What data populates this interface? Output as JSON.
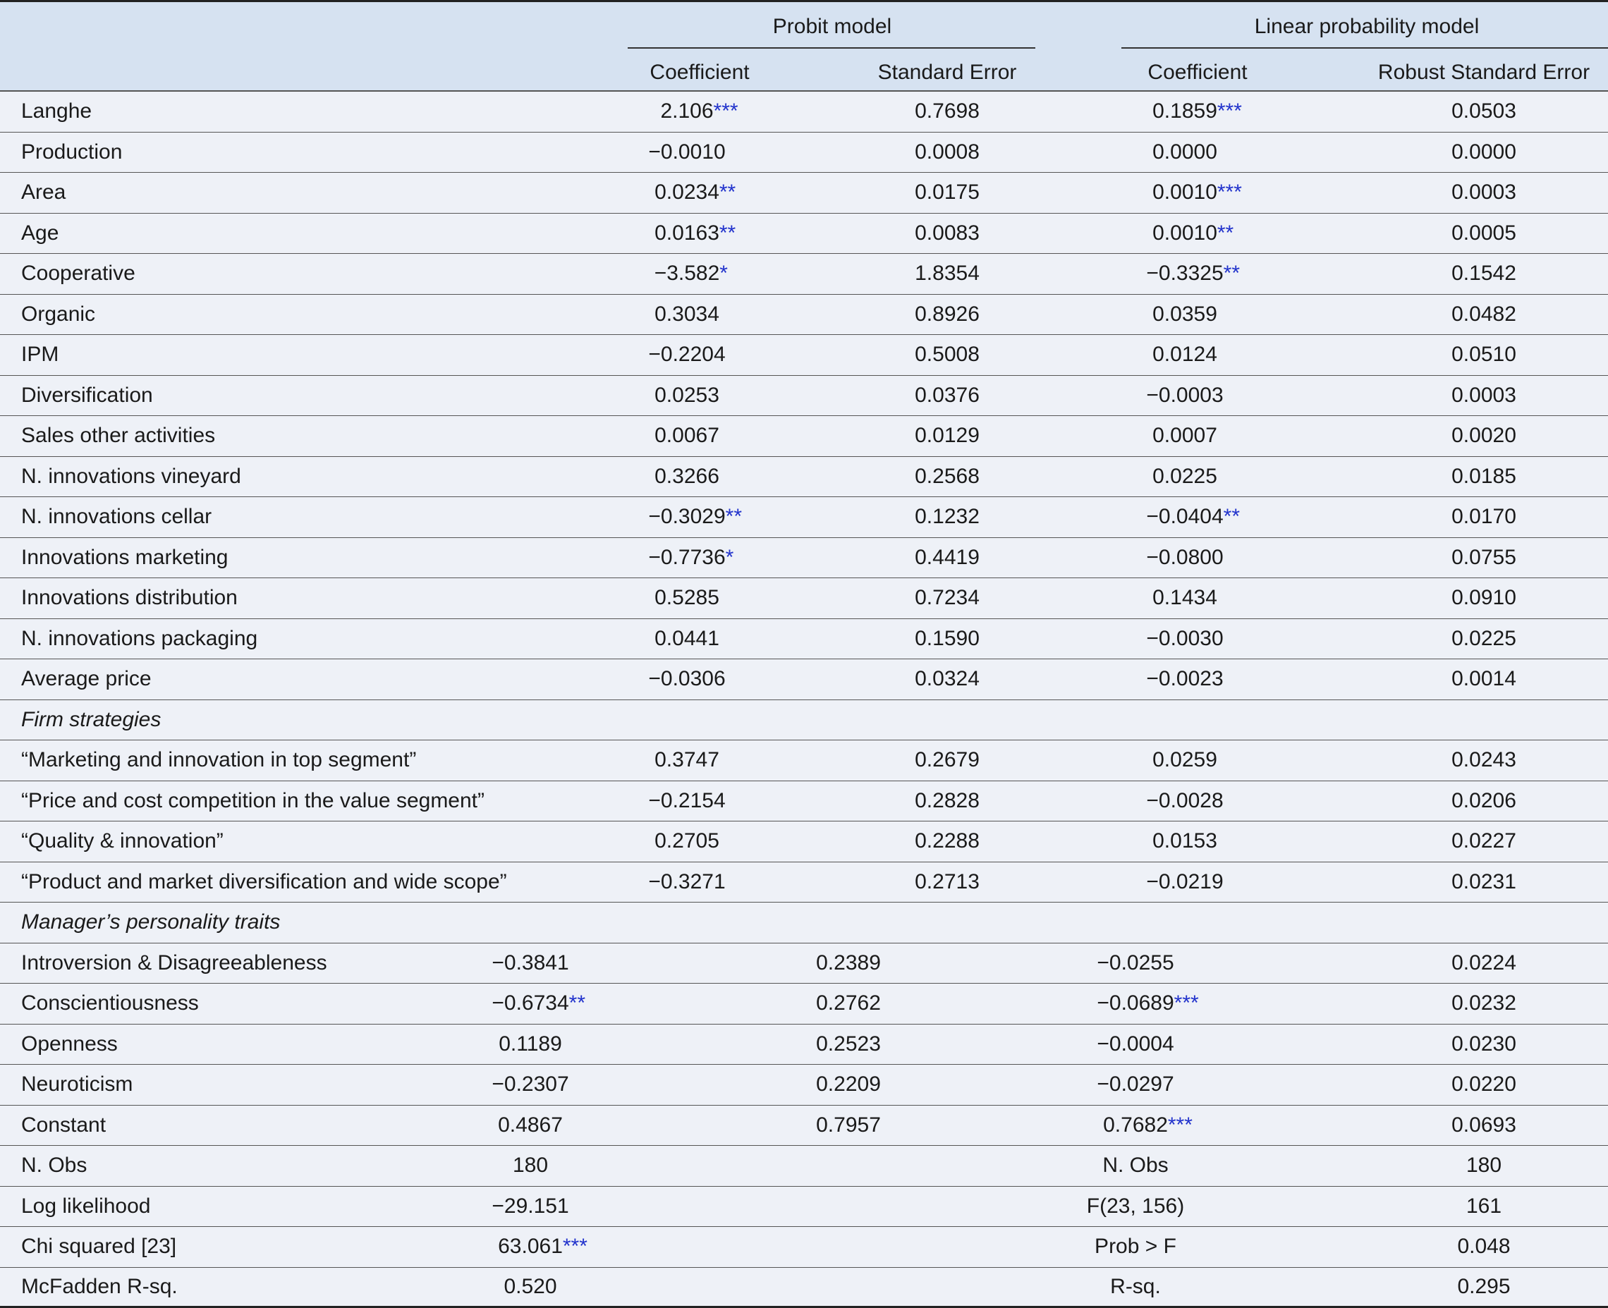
{
  "header": {
    "group_probit": "Probit model",
    "group_lpm": "Linear probability model",
    "col_probit_coef": "Coefficient",
    "col_probit_se": "Standard Error",
    "col_lpm_coef": "Coefficient",
    "col_lpm_se": "Robust Standard Error"
  },
  "rows": [
    {
      "label": "Langhe",
      "pc": "2.106",
      "pcs": "***",
      "pse": "0.7698",
      "lc": "0.1859",
      "lcs": "***",
      "lse": "0.0503"
    },
    {
      "label": "Production",
      "pc": "−0.0010",
      "pcs": "",
      "pse": "0.0008",
      "lc": "0.0000",
      "lcs": "",
      "lse": "0.0000"
    },
    {
      "label": "Area",
      "pc": "0.0234",
      "pcs": "**",
      "pse": "0.0175",
      "lc": "0.0010",
      "lcs": "***",
      "lse": "0.0003"
    },
    {
      "label": "Age",
      "pc": "0.0163",
      "pcs": "**",
      "pse": "0.0083",
      "lc": "0.0010",
      "lcs": "**",
      "lse": "0.0005"
    },
    {
      "label": "Cooperative",
      "pc": "−3.582",
      "pcs": "*",
      "pse": "1.8354",
      "lc": "−0.3325",
      "lcs": "**",
      "lse": "0.1542"
    },
    {
      "label": "Organic",
      "pc": "0.3034",
      "pcs": "",
      "pse": "0.8926",
      "lc": "0.0359",
      "lcs": "",
      "lse": "0.0482"
    },
    {
      "label": "IPM",
      "pc": "−0.2204",
      "pcs": "",
      "pse": "0.5008",
      "lc": "0.0124",
      "lcs": "",
      "lse": "0.0510"
    },
    {
      "label": "Diversification",
      "pc": "0.0253",
      "pcs": "",
      "pse": "0.0376",
      "lc": "−0.0003",
      "lcs": "",
      "lse": "0.0003"
    },
    {
      "label": "Sales other activities",
      "pc": "0.0067",
      "pcs": "",
      "pse": "0.0129",
      "lc": "0.0007",
      "lcs": "",
      "lse": "0.0020"
    },
    {
      "label": "N. innovations vineyard",
      "pc": "0.3266",
      "pcs": "",
      "pse": "0.2568",
      "lc": "0.0225",
      "lcs": "",
      "lse": "0.0185"
    },
    {
      "label": "N. innovations cellar",
      "pc": "−0.3029",
      "pcs": "**",
      "pse": "0.1232",
      "lc": "−0.0404",
      "lcs": "**",
      "lse": "0.0170"
    },
    {
      "label": "Innovations marketing",
      "pc": "−0.7736",
      "pcs": "*",
      "pse": "0.4419",
      "lc": "−0.0800",
      "lcs": "",
      "lse": "0.0755"
    },
    {
      "label": "Innovations distribution",
      "pc": "0.5285",
      "pcs": "",
      "pse": "0.7234",
      "lc": "0.1434",
      "lcs": "",
      "lse": "0.0910"
    },
    {
      "label": "N. innovations packaging",
      "pc": "0.0441",
      "pcs": "",
      "pse": "0.1590",
      "lc": "−0.0030",
      "lcs": "",
      "lse": "0.0225"
    },
    {
      "label": "Average price",
      "pc": "−0.0306",
      "pcs": "",
      "pse": "0.0324",
      "lc": "−0.0023",
      "lcs": "",
      "lse": "0.0014"
    },
    {
      "label": "Firm strategies",
      "section": true
    },
    {
      "label": "“Marketing and innovation in top segment”",
      "pc": "0.3747",
      "pcs": "",
      "pse": "0.2679",
      "lc": "0.0259",
      "lcs": "",
      "lse": "0.0243"
    },
    {
      "label": "“Price and cost competition in the value segment”",
      "pc": "−0.2154",
      "pcs": "",
      "pse": "0.2828",
      "lc": "−0.0028",
      "lcs": "",
      "lse": "0.0206"
    },
    {
      "label": "“Quality & innovation”",
      "pc": "0.2705",
      "pcs": "",
      "pse": "0.2288",
      "lc": "0.0153",
      "lcs": "",
      "lse": "0.0227"
    },
    {
      "label": "“Product and market diversification and wide scope”",
      "pc": "−0.3271",
      "pcs": "",
      "pse": "0.2713",
      "lc": "−0.0219",
      "lcs": "",
      "lse": "0.0231"
    },
    {
      "label": "Manager’s personality traits",
      "section": true
    },
    {
      "label": "Introversion & Disagreeableness",
      "pc": "−0.3841",
      "pcs": "",
      "pse": "0.2389",
      "lc": "−0.0255",
      "lcs": "",
      "lse": "0.0224",
      "shifted": true
    },
    {
      "label": "Conscientiousness",
      "pc": "−0.6734",
      "pcs": "**",
      "pse": "0.2762",
      "lc": "−0.0689",
      "lcs": "***",
      "lse": "0.0232",
      "shifted": true
    },
    {
      "label": "Openness",
      "pc": "0.1189",
      "pcs": "",
      "pse": "0.2523",
      "lc": "−0.0004",
      "lcs": "",
      "lse": "0.0230",
      "shifted": true
    },
    {
      "label": "Neuroticism",
      "pc": "−0.2307",
      "pcs": "",
      "pse": "0.2209",
      "lc": "−0.0297",
      "lcs": "",
      "lse": "0.0220",
      "shifted": true
    },
    {
      "label": "Constant",
      "pc": "0.4867",
      "pcs": "",
      "pse": "0.7957",
      "lc": "0.7682",
      "lcs": "***",
      "lse": "0.0693",
      "shifted": true
    },
    {
      "label": "N. Obs",
      "pc": "180",
      "pcs": "",
      "pse": "",
      "lc": "N. Obs",
      "lcs": "",
      "lse": "180",
      "stats": true
    },
    {
      "label": "Log likelihood",
      "pc": "−29.151",
      "pcs": "",
      "pse": "",
      "lc": "F(23, 156)",
      "lcs": "",
      "lse": "161",
      "stats": true
    },
    {
      "label": "Chi squared [23]",
      "pc": "63.061",
      "pcs": "***",
      "pse": "",
      "lc": "Prob > F",
      "lcs": "",
      "lse": "0.048",
      "stats": true
    },
    {
      "label": "McFadden R-sq.",
      "pc": "0.520",
      "pcs": "",
      "pse": "",
      "lc": "R-sq.",
      "lcs": "",
      "lse": "0.295",
      "stats": true
    }
  ]
}
